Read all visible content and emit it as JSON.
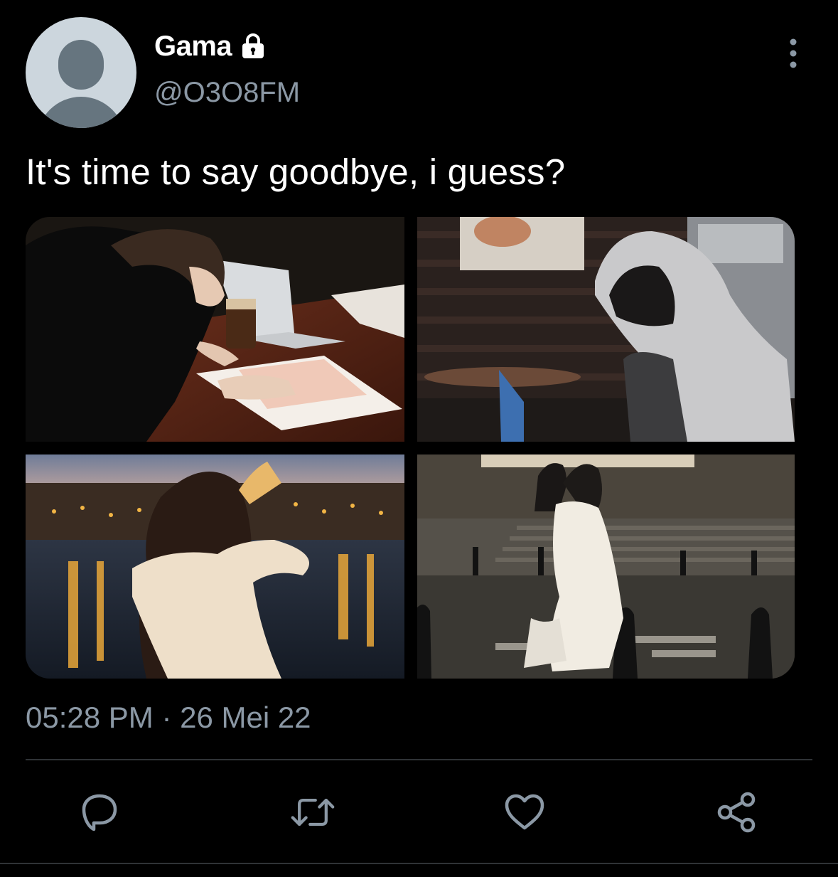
{
  "tweet": {
    "author": {
      "name": "Gama",
      "handle": "@O3O8FM",
      "protected_icon": "lock-icon"
    },
    "text": "It's time to say goodbye, i guess?",
    "timestamp": "05:28 PM · 26 Mei 22",
    "media": [
      {
        "icon": "photo-girl-studying"
      },
      {
        "icon": "photo-hooded-person-cafe"
      },
      {
        "icon": "photo-girl-by-river-night"
      },
      {
        "icon": "photo-couple-walking-plaza"
      }
    ],
    "actions": [
      {
        "icon": "reply-icon"
      },
      {
        "icon": "retweet-icon"
      },
      {
        "icon": "like-icon"
      },
      {
        "icon": "share-icon"
      }
    ]
  },
  "colors": {
    "background": "#000000",
    "text": "#ffffff",
    "secondary": "#8b98a5",
    "divider": "#2f3336",
    "avatar_bg": "#ccd6dd",
    "avatar_fg": "#66757f"
  }
}
